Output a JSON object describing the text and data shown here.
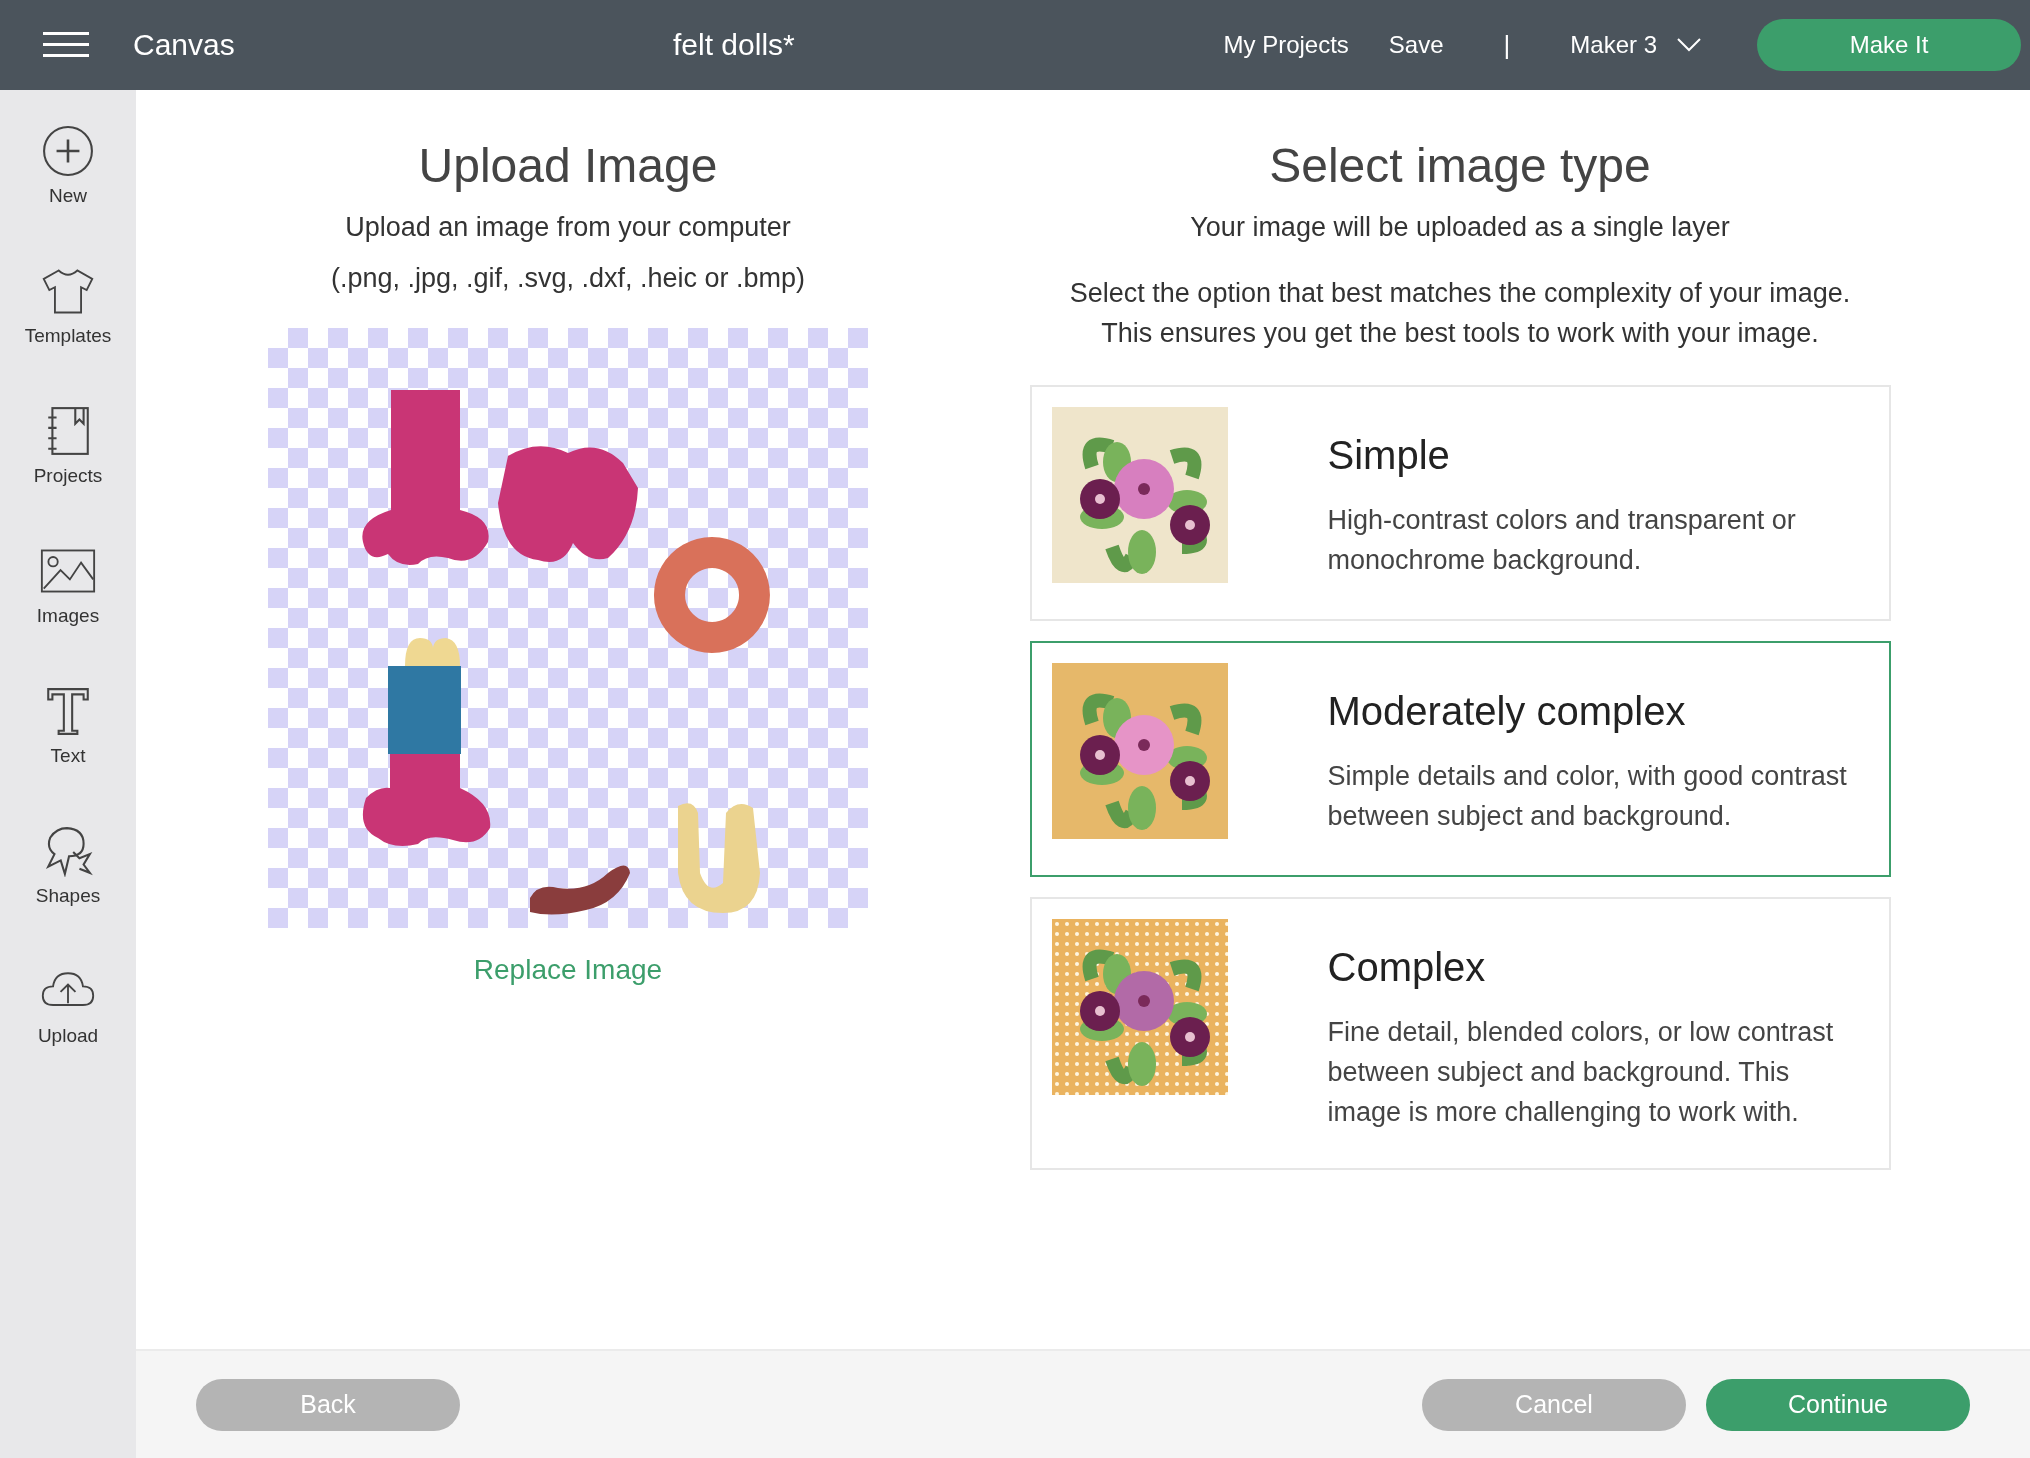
{
  "header": {
    "app_name": "Canvas",
    "project_title": "felt dolls*",
    "links": [
      "My Projects",
      "Save"
    ],
    "separator": "|",
    "machine": "Maker 3",
    "make_button": "Make It"
  },
  "sidebar": {
    "items": [
      {
        "label": "New"
      },
      {
        "label": "Templates"
      },
      {
        "label": "Projects"
      },
      {
        "label": "Images"
      },
      {
        "label": "Text"
      },
      {
        "label": "Shapes"
      },
      {
        "label": "Upload"
      }
    ]
  },
  "upload": {
    "title": "Upload Image",
    "subtitle": "Upload an image from your computer",
    "formats": "(.png, .jpg, .gif, .svg, .dxf, .heic or .bmp)",
    "replace_link": "Replace Image"
  },
  "image_type": {
    "title": "Select image type",
    "subtitle": "Your image will be uploaded as a single layer",
    "instructions": [
      "Select the option that best matches the complexity of your image.",
      "This ensures you get the best tools to work with your image."
    ],
    "options": [
      {
        "kind": "plain",
        "title": "Simple",
        "description": "High-contrast colors and transparent or monochrome background.",
        "selected": false
      },
      {
        "kind": "solid",
        "title": "Moderately complex",
        "description": "Simple details and color, with good contrast between subject and background.",
        "selected": true
      },
      {
        "kind": "dotted",
        "title": "Complex",
        "description": "Fine detail, blended colors, or low contrast between subject and background. This image is more challenging to work with.",
        "selected": false
      }
    ]
  },
  "footer": {
    "buttons": [
      {
        "label": "Back",
        "disabled": true
      },
      {
        "label": "Cancel",
        "disabled": true
      },
      {
        "label": "Continue",
        "disabled": false
      }
    ]
  }
}
